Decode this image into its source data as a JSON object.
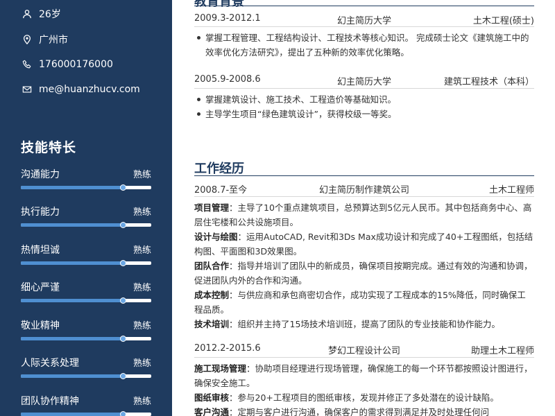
{
  "sidebar": {
    "contact": {
      "age": "26岁",
      "city": "广州市",
      "phone": "176000176000",
      "email": "me@huanzhucv.com"
    },
    "skills_title": "技能特长",
    "skills": [
      {
        "name": "沟通能力",
        "level": "熟练",
        "value": 0.78
      },
      {
        "name": "执行能力",
        "level": "熟练",
        "value": 0.78
      },
      {
        "name": "热情坦诚",
        "level": "熟练",
        "value": 0.78
      },
      {
        "name": "细心严谨",
        "level": "熟练",
        "value": 0.78
      },
      {
        "name": "敬业精神",
        "level": "熟练",
        "value": 0.78
      },
      {
        "name": "人际关系处理",
        "level": "熟练",
        "value": 0.78
      },
      {
        "name": "团队协作精神",
        "level": "熟练",
        "value": 0.78
      }
    ]
  },
  "education": {
    "title": "教育背景",
    "entries": [
      {
        "date": "2009.3-2012.1",
        "school": "幻主简历大学",
        "major": "土木工程(硕士)",
        "bullets": [
          "掌握工程管理、工程结构设计、工程技术等核心知识。 完成硕士论文《建筑施工中的效率优化方法研究》，提出了五种新的效率优化策略。"
        ]
      },
      {
        "date": "2005.9-2008.6",
        "school": "幻主简历大学",
        "major": "建筑工程技术（本科）",
        "bullets": [
          "掌握建筑设计、施工技术、工程造价等基础知识。",
          "主导学生项目“绿色建筑设计”，获得校级一等奖。"
        ]
      }
    ]
  },
  "work": {
    "title": "工作经历",
    "entries": [
      {
        "date": "2008.7-至今",
        "company": "幻主简历制作建筑公司",
        "role": "土木工程师",
        "items": [
          {
            "label": "项目管理",
            "text": "：主导了10个重点建筑项目，总预算达到5亿元人民币。其中包括商务中心、高层住宅楼和公共设施项目。"
          },
          {
            "label": "设计与绘图",
            "text": "：运用AutoCAD, Revit和3Ds Max成功设计和完成了40+工程图纸，包括结构图、平面图和3D效果图。"
          },
          {
            "label": "团队合作",
            "text": "：指导并培训了团队中的新成员，确保项目按期完成。通过有效的沟通和协调，促进团队内外的合作和沟通。"
          },
          {
            "label": "成本控制",
            "text": "：与供应商和承包商密切合作，成功实现了工程成本的15%降低，同时确保工程品质。"
          },
          {
            "label": "技术培训",
            "text": "：组织并主持了15场技术培训班，提高了团队的专业技能和协作能力。"
          }
        ]
      },
      {
        "date": "2012.2-2015.6",
        "company": "梦幻工程设计公司",
        "role": "助理土木工程师",
        "items": [
          {
            "label": "施工现场管理",
            "text": "：协助项目经理进行现场管理，确保施工的每一个环节都按照设计图进行，确保安全施工。"
          },
          {
            "label": "图纸审核",
            "text": "：参与20+工程项目的图纸审核，发现并修正了多处潜在的设计缺陷。"
          },
          {
            "label": "客户沟通",
            "text": "：定期与客户进行沟通，确保客户的需求得到满足并及时处理任何问"
          }
        ]
      }
    ]
  }
}
